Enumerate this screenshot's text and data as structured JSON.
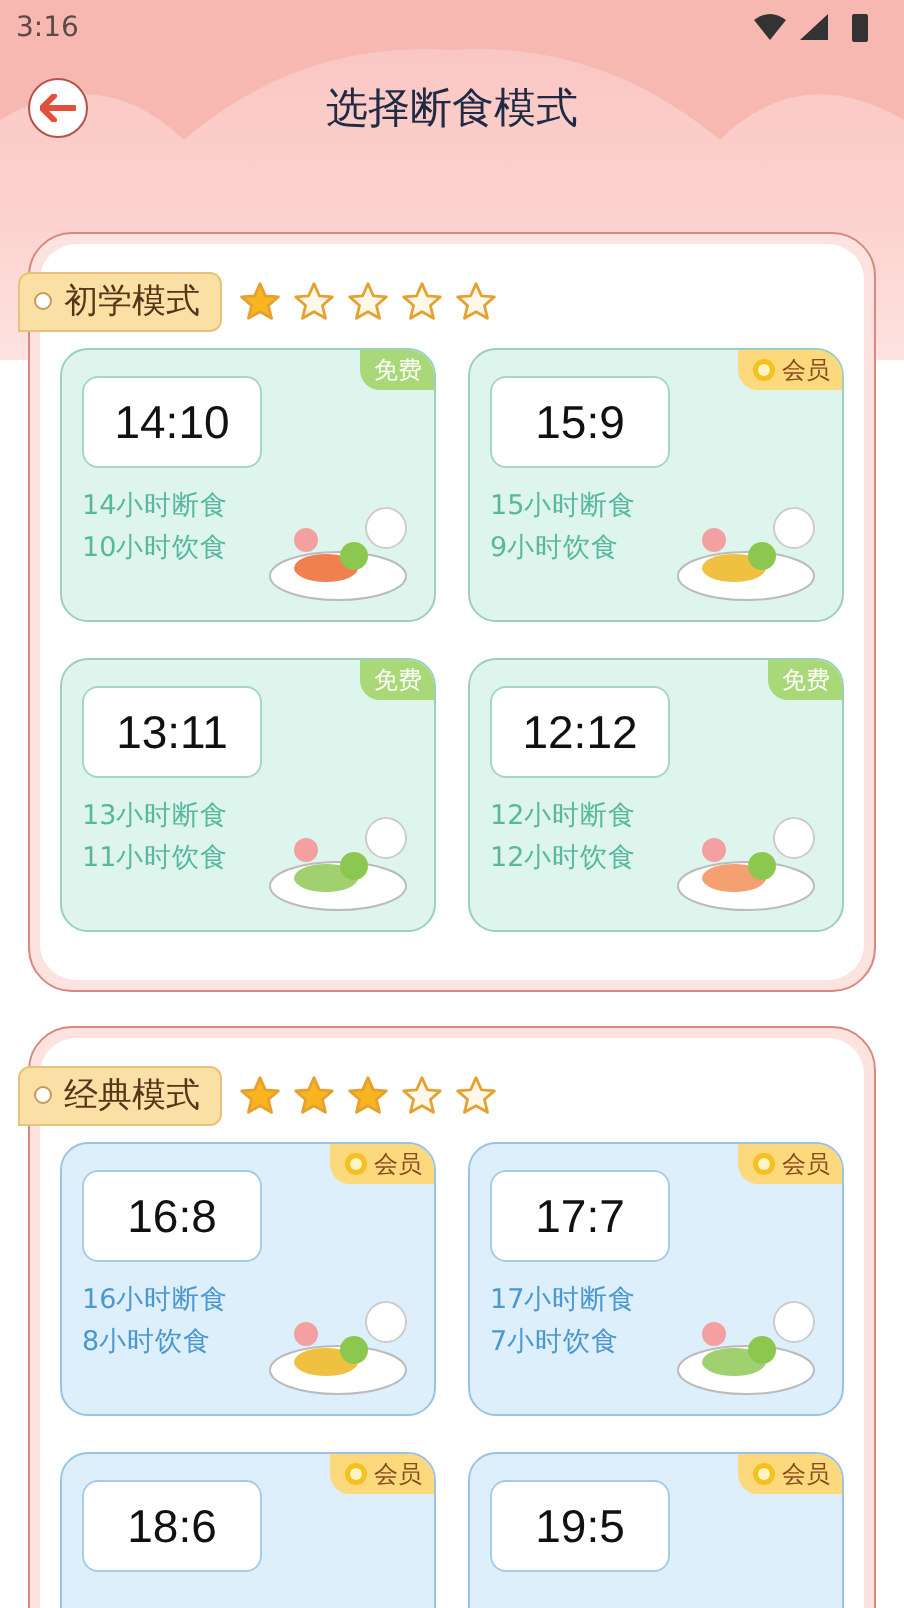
{
  "status_bar": {
    "time": "3:16"
  },
  "header": {
    "title": "选择断食模式"
  },
  "sections": [
    {
      "title": "初学模式",
      "stars": 1,
      "kind": "green",
      "plans": [
        {
          "ratio": "14:10",
          "fasting": "14小时断食",
          "eating": "10小时饮食",
          "badge": {
            "kind": "free",
            "label": "免费"
          }
        },
        {
          "ratio": "15:9",
          "fasting": "15小时断食",
          "eating": "9小时饮食",
          "badge": {
            "kind": "vip",
            "label": "会员"
          }
        },
        {
          "ratio": "13:11",
          "fasting": "13小时断食",
          "eating": "11小时饮食",
          "badge": {
            "kind": "free",
            "label": "免费"
          }
        },
        {
          "ratio": "12:12",
          "fasting": "12小时断食",
          "eating": "12小时饮食",
          "badge": {
            "kind": "free",
            "label": "免费"
          }
        }
      ]
    },
    {
      "title": "经典模式",
      "stars": 3,
      "kind": "blue",
      "plans": [
        {
          "ratio": "16:8",
          "fasting": "16小时断食",
          "eating": "8小时饮食",
          "badge": {
            "kind": "vip",
            "label": "会员"
          }
        },
        {
          "ratio": "17:7",
          "fasting": "17小时断食",
          "eating": "7小时饮食",
          "badge": {
            "kind": "vip",
            "label": "会员"
          }
        },
        {
          "ratio": "18:6",
          "badge": {
            "kind": "vip",
            "label": "会员"
          }
        },
        {
          "ratio": "19:5",
          "badge": {
            "kind": "vip",
            "label": "会员"
          }
        }
      ]
    }
  ]
}
